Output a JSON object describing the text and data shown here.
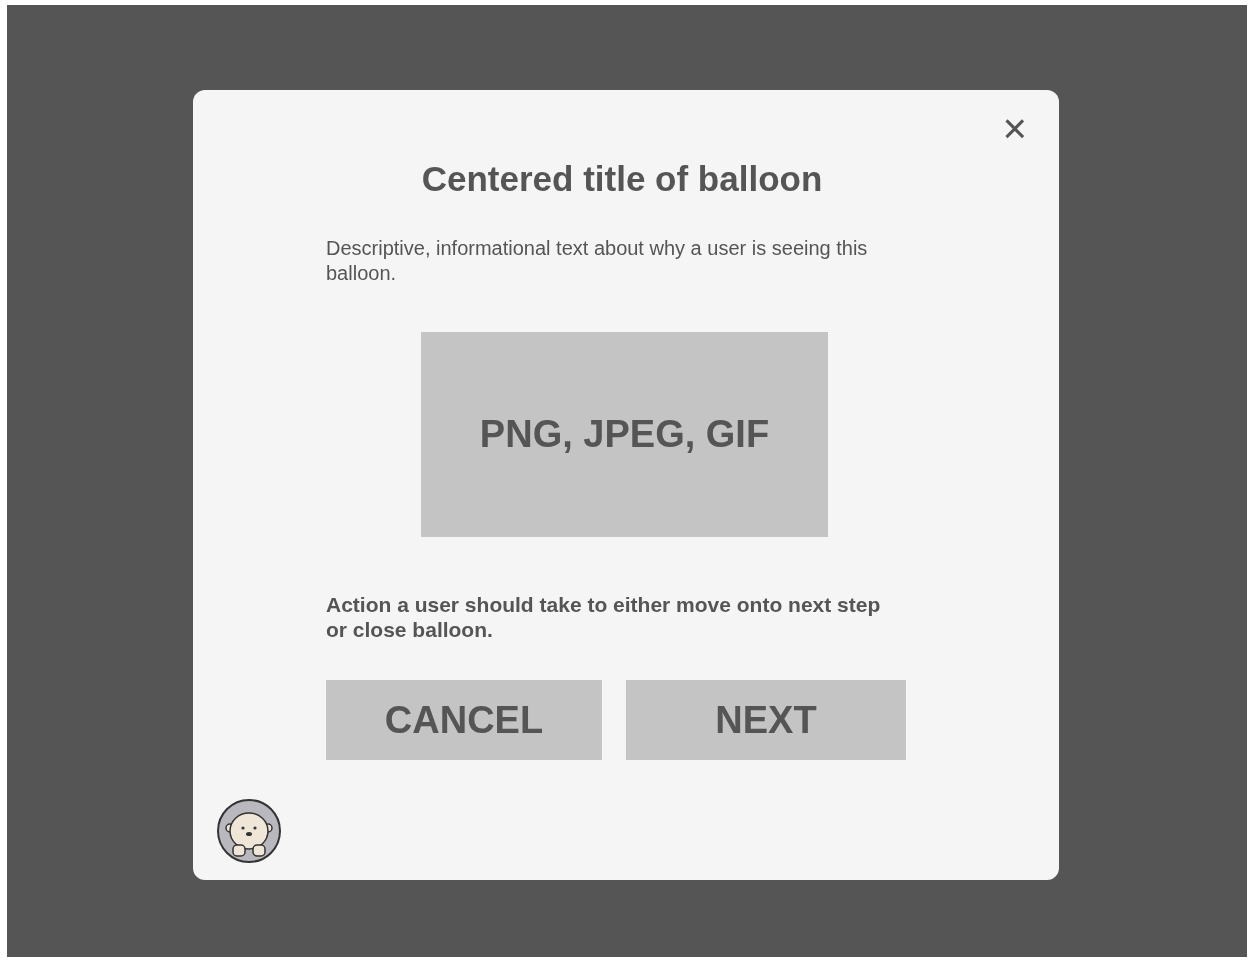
{
  "dialog": {
    "close_label": "×",
    "title": "Centered title of balloon",
    "description": "Descriptive, informational text about why a user is seeing this balloon.",
    "image_placeholder": "PNG, JPEG, GIF",
    "action_text": "Action a user should take to either move onto next step or close balloon.",
    "buttons": [
      {
        "label": "CANCEL",
        "kind": "cancel"
      },
      {
        "label": "NEXT",
        "kind": "next"
      }
    ]
  }
}
